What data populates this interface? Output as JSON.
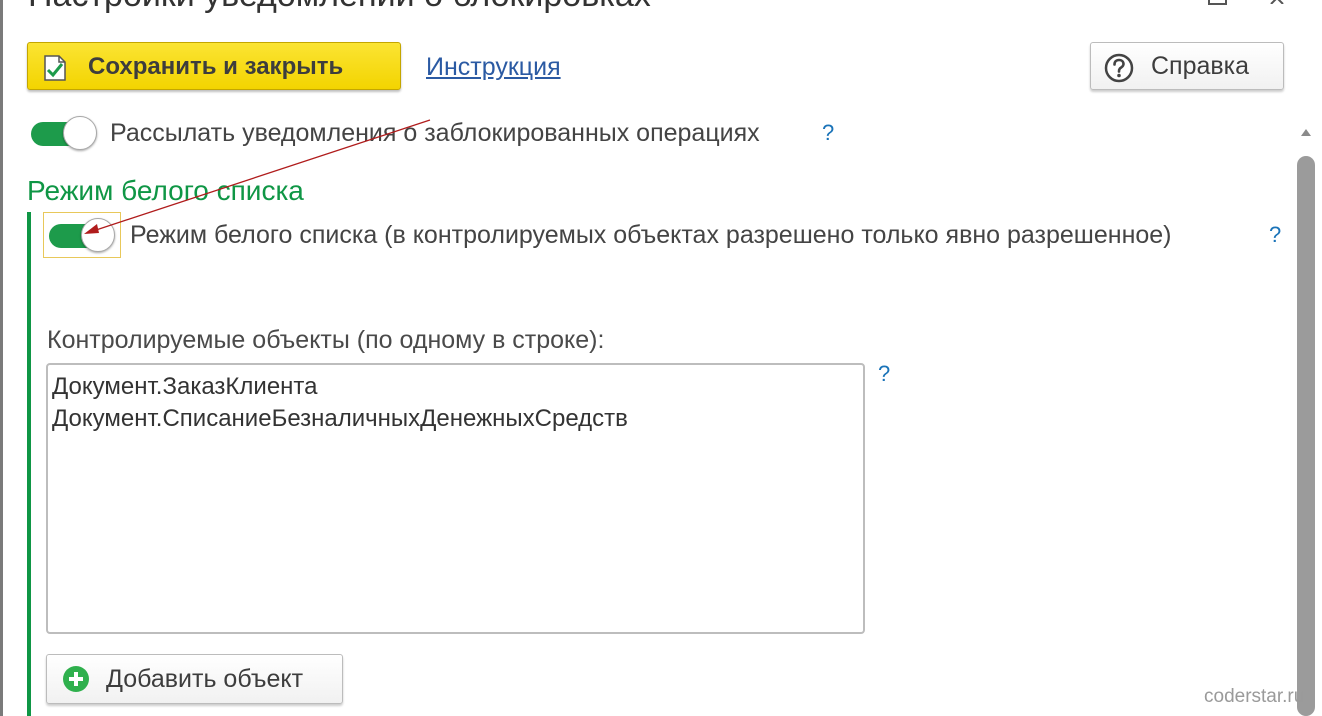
{
  "window": {
    "title": "Настройки уведомлений о блокировках"
  },
  "toolbar": {
    "save_label": "Сохранить и закрыть",
    "instruction_label": "Инструкция",
    "help_label": "Справка"
  },
  "notify": {
    "label": "Рассылать уведомления о заблокированных операциях",
    "enabled": true,
    "hint": "?"
  },
  "whitelist_section": {
    "title": "Режим белого списка",
    "toggle_label": "Режим белого списка (в контролируемых объектах разрешено только явно разрешенное)",
    "enabled": true,
    "hint": "?",
    "objects_label": "Контролируемые объекты (по одному в строке):",
    "objects": [
      "Документ.ЗаказКлиента",
      "Документ.СписаниеБезналичныхДенежныхСредств"
    ],
    "objects_hint": "?",
    "add_label": "Добавить объект"
  },
  "colors": {
    "accent_green": "#0f9645",
    "toggle_green": "#1d9b4b",
    "save_yellow": "#f3d400",
    "link_blue": "#2b5aa3",
    "hint_blue": "#1a73b8",
    "annotation_red": "#b01c1c"
  },
  "icons": {
    "save": "save-document-check-icon",
    "help": "question-circle-icon",
    "add": "plus-circle-icon",
    "more": "more-dots-icon",
    "maximize": "maximize-icon",
    "close": "close-icon"
  },
  "watermark": "coderstar.ru"
}
